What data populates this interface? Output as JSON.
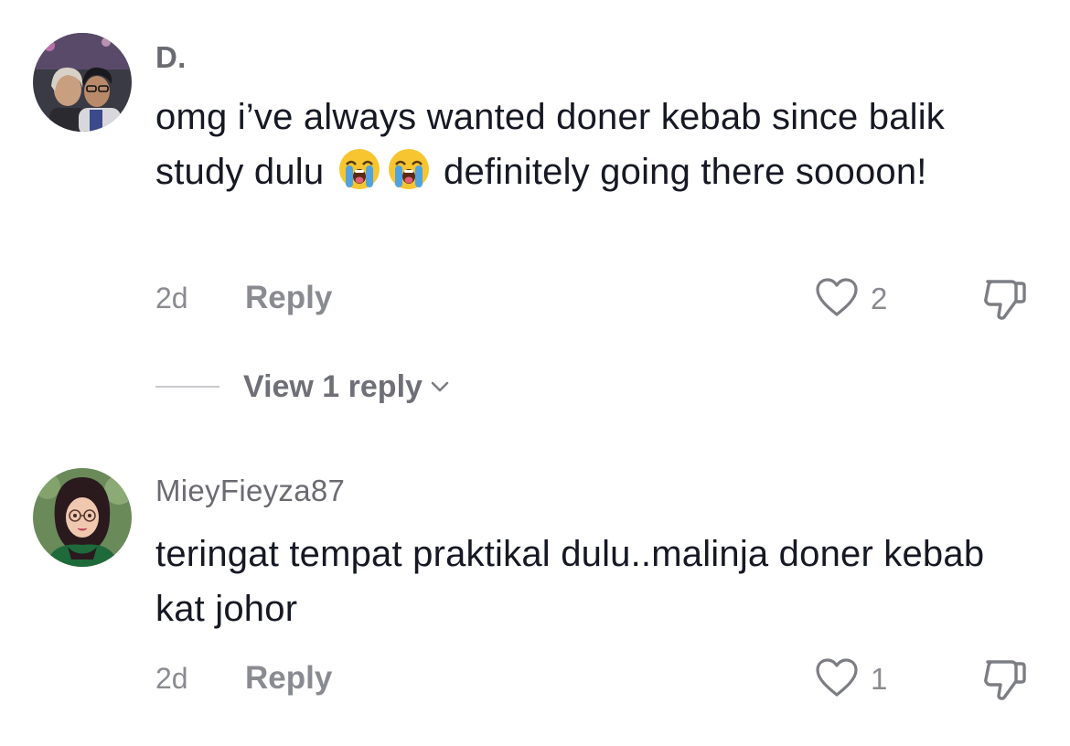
{
  "comments": [
    {
      "username": "D.",
      "text_before_emoji": "omg i’ve always wanted doner kebab since balik study dulu",
      "emojis": [
        "loudly-crying-face",
        "loudly-crying-face"
      ],
      "text_after_emoji": "definitely going there soooon!",
      "time": "2d",
      "reply_label": "Reply",
      "likes": "2",
      "view_replies_label": "View 1 reply"
    },
    {
      "username": "MieyFieyza87",
      "text": "teringat tempat praktikal dulu..malinja doner kebab kat johor",
      "time": "2d",
      "reply_label": "Reply",
      "likes": "1"
    }
  ],
  "icons": {
    "like": "heart-outline-icon",
    "dislike": "thumbs-down-icon",
    "expand": "chevron-down-icon"
  },
  "colors": {
    "text": "#161823",
    "secondary": "#8a8b91",
    "emoji_face": "#f7c530",
    "emoji_tears": "#4fa3e0"
  }
}
